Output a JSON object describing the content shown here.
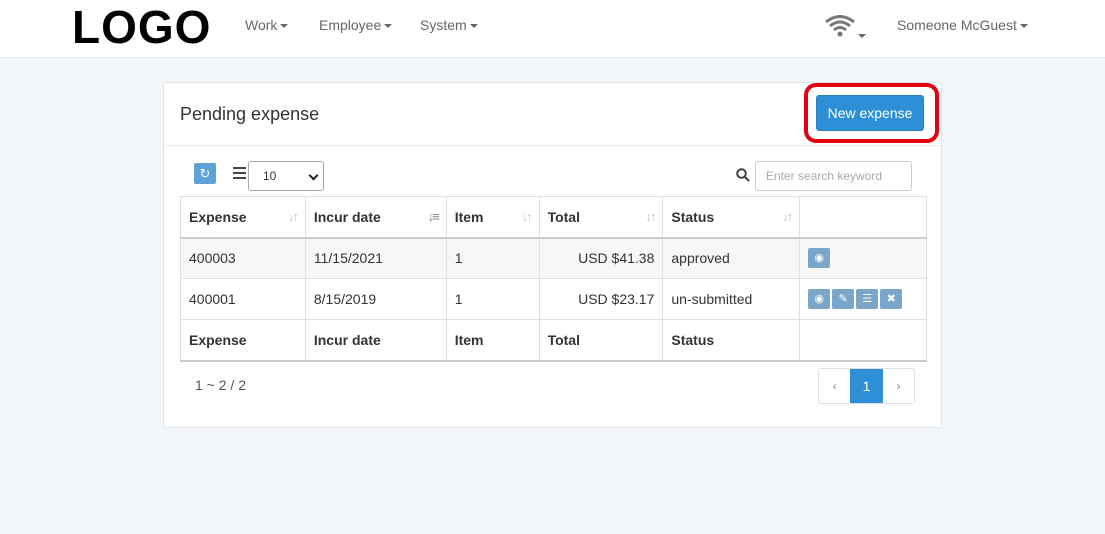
{
  "nav": {
    "logo": "LOGO",
    "menu": [
      {
        "label": "Work"
      },
      {
        "label": "Employee"
      },
      {
        "label": "System"
      }
    ],
    "user": "Someone McGuest",
    "wifi_icon": "wifi-icon"
  },
  "panel": {
    "title": "Pending expense",
    "new_button": "New expense",
    "page_size": "10",
    "search_placeholder": "Enter search keyword"
  },
  "table": {
    "headers": [
      "Expense",
      "Incur date",
      "Item",
      "Total",
      "Status"
    ],
    "rows": [
      {
        "expense": "400003",
        "date": "11/15/2021",
        "item": "1",
        "total": "USD $41.38",
        "status": "approved",
        "actions": [
          "view"
        ]
      },
      {
        "expense": "400001",
        "date": "8/15/2019",
        "item": "1",
        "total": "USD $23.17",
        "status": "un-submitted",
        "actions": [
          "view",
          "edit",
          "submit",
          "delete"
        ]
      }
    ],
    "footer": [
      "Expense",
      "Incur date",
      "Item",
      "Total",
      "Status"
    ]
  },
  "pagination": {
    "info": "1 ~ 2 / 2",
    "prev": "‹",
    "current": "1",
    "next": "›"
  },
  "colors": {
    "primary": "#2d8fd5",
    "highlight": "#e3000f",
    "action": "#7aa7c9"
  }
}
